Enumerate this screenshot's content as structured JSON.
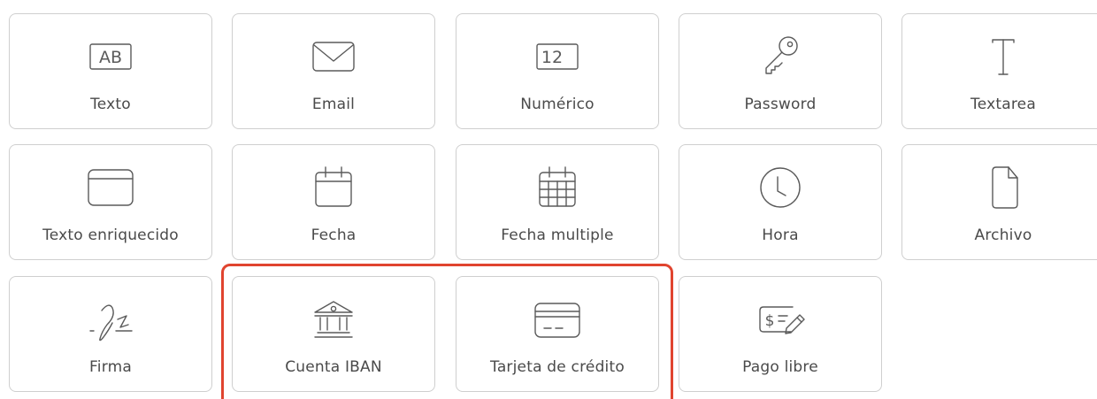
{
  "fields": [
    {
      "label": "Texto",
      "icon": "ab-text-icon",
      "badge": "AB"
    },
    {
      "label": "Email",
      "icon": "envelope-icon"
    },
    {
      "label": "Numérico",
      "icon": "number-box-icon",
      "badge": "12"
    },
    {
      "label": "Password",
      "icon": "key-icon"
    },
    {
      "label": "Textarea",
      "icon": "text-cursor-icon"
    },
    {
      "label": "Texto enriquecido",
      "icon": "window-icon"
    },
    {
      "label": "Fecha",
      "icon": "calendar-icon"
    },
    {
      "label": "Fecha multiple",
      "icon": "calendar-grid-icon"
    },
    {
      "label": "Hora",
      "icon": "clock-icon"
    },
    {
      "label": "Archivo",
      "icon": "file-icon"
    },
    {
      "label": "Firma",
      "icon": "signature-icon"
    },
    {
      "label": "Cuenta IBAN",
      "icon": "bank-icon"
    },
    {
      "label": "Tarjeta de crédito",
      "icon": "credit-card-icon"
    },
    {
      "label": "Pago libre",
      "icon": "payment-check-icon",
      "badge": "$"
    }
  ],
  "highlight_color": "#e0442f"
}
